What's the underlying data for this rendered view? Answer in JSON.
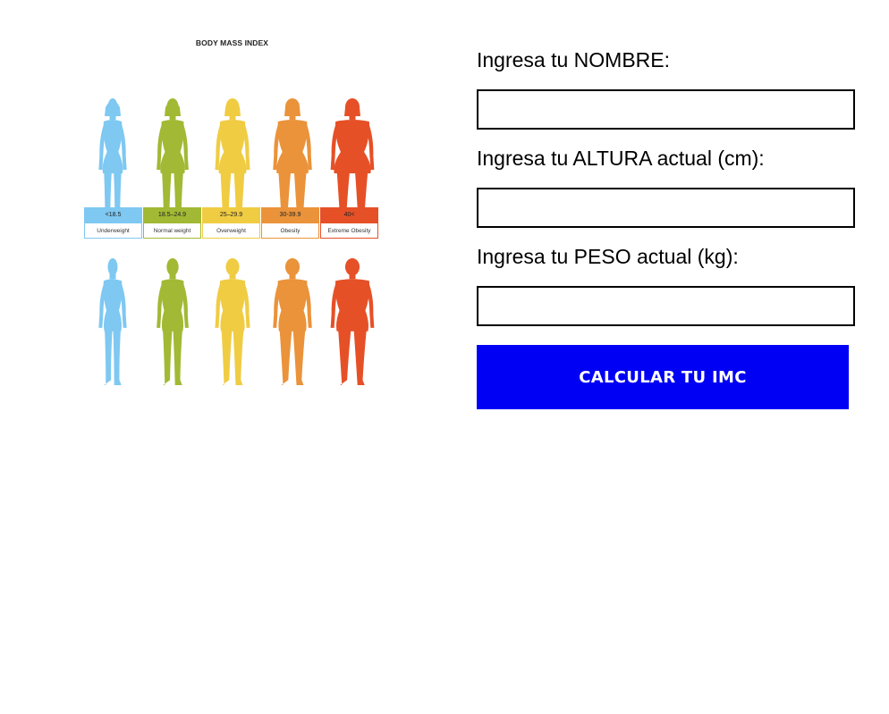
{
  "infographic": {
    "title": "BODY MASS INDEX",
    "categories": [
      {
        "range": "<18.5",
        "label": "Underweight",
        "color": "#7ec8f2",
        "shape": "thin"
      },
      {
        "range": "18.5–24.9",
        "label": "Normal weight",
        "color": "#a1b934",
        "shape": "normal"
      },
      {
        "range": "25–29.9",
        "label": "Overweight",
        "color": "#f0cc43",
        "shape": "over"
      },
      {
        "range": "30-39.9",
        "label": "Obesity",
        "color": "#ea933a",
        "shape": "obese"
      },
      {
        "range": "40<",
        "label": "Extreme Obesity",
        "color": "#e65027",
        "shape": "extreme"
      }
    ]
  },
  "form": {
    "nombre_label": "Ingresa tu NOMBRE:",
    "nombre_value": "",
    "altura_label": "Ingresa tu ALTURA actual (cm):",
    "altura_value": "",
    "peso_label": "Ingresa tu PESO actual (kg):",
    "peso_value": "",
    "submit_label": "CALCULAR TU IMC",
    "submit_color": "#0000f5"
  }
}
